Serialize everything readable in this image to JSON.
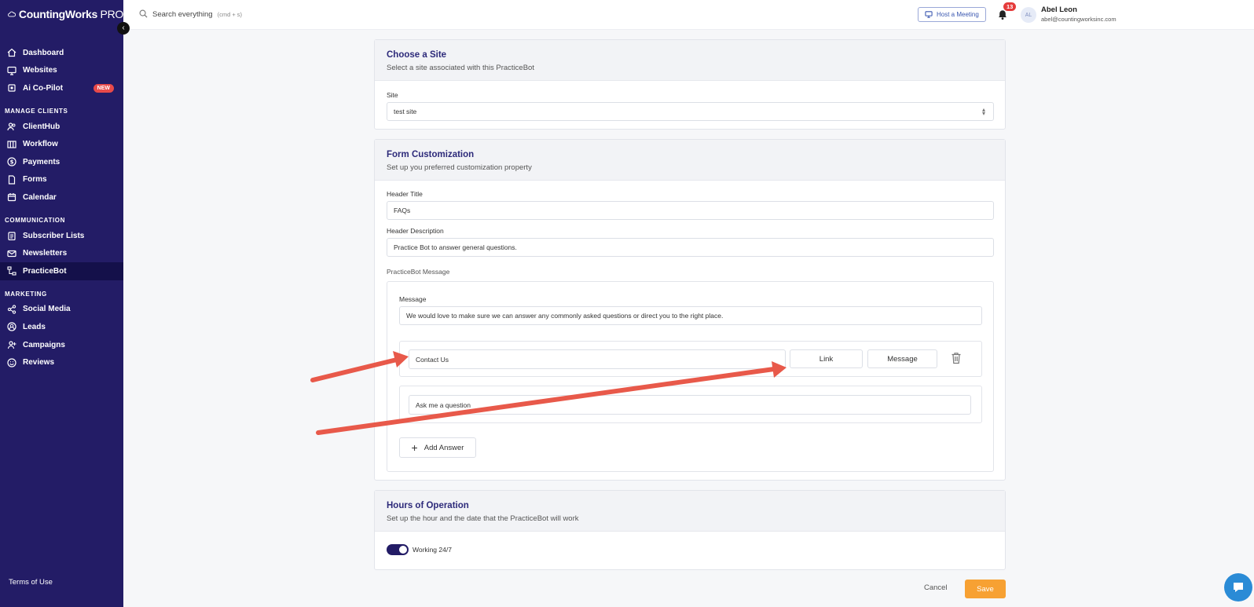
{
  "brand": {
    "name": "CountingWorks",
    "suffix": "PRO"
  },
  "search": {
    "placeholder": "Search everything",
    "hint": "(cmd + s)"
  },
  "header": {
    "host_meeting": "Host a Meeting",
    "notifications_count": "13",
    "user_initials": "AL",
    "user_name": "Abel Leon",
    "user_email": "abel@countingworksinc.com"
  },
  "sidebar": {
    "top_items": [
      {
        "label": "Dashboard",
        "icon": "home-icon"
      },
      {
        "label": "Websites",
        "icon": "monitor-icon"
      },
      {
        "label": "Ai Co-Pilot",
        "icon": "chip-icon",
        "badge": "NEW"
      }
    ],
    "sections": [
      {
        "title": "MANAGE CLIENTS",
        "items": [
          "ClientHub",
          "Workflow",
          "Payments",
          "Forms",
          "Calendar"
        ]
      },
      {
        "title": "COMMUNICATION",
        "items": [
          "Subscriber Lists",
          "Newsletters",
          "PracticeBot"
        ]
      },
      {
        "title": "MARKETING",
        "items": [
          "Social Media",
          "Leads",
          "Campaigns",
          "Reviews"
        ]
      }
    ],
    "active": "PracticeBot",
    "terms": "Terms of Use"
  },
  "site_card": {
    "title": "Choose a Site",
    "subtitle": "Select a site associated with this PracticeBot",
    "site_label": "Site",
    "site_value": "test site"
  },
  "form_card": {
    "title": "Form Customization",
    "subtitle": "Set up you preferred customization property",
    "header_title_label": "Header Title",
    "header_title_value": "FAQs",
    "header_desc_label": "Header Description",
    "header_desc_value": "Practice Bot to answer general questions.",
    "message_section_label": "PracticeBot Message",
    "message_label": "Message",
    "message_value": "We would love to make sure we can answer any commonly asked questions or direct you to the right place.",
    "answer1_value": "Contact Us",
    "link_button": "Link",
    "message_button": "Message",
    "answer2_value": "Ask me a question",
    "add_answer": "Add Answer"
  },
  "hours_card": {
    "title": "Hours of Operation",
    "subtitle": "Set up the hour and the date that the PracticeBot will work",
    "toggle_label": "Working 24/7",
    "toggle_on": true
  },
  "footer": {
    "cancel": "Cancel",
    "save": "Save"
  },
  "colors": {
    "sidebar": "#231c66",
    "accent": "#f7a133",
    "annotation_arrow": "#e8594a"
  }
}
